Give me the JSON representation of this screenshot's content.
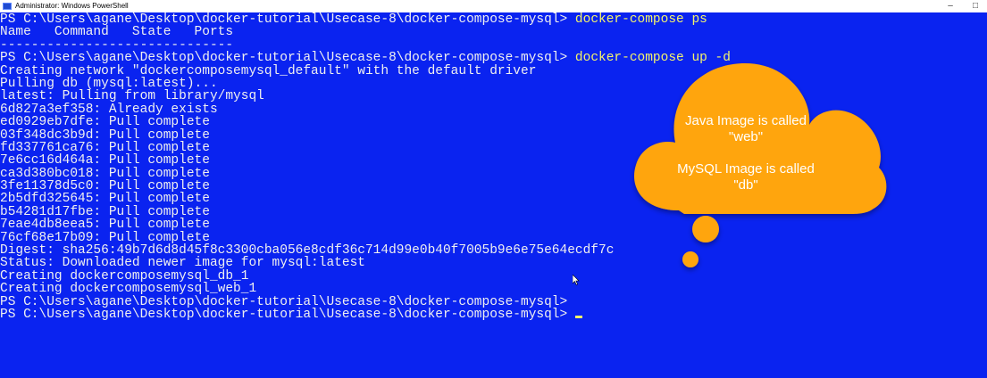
{
  "window": {
    "title": "Administrator: Windows PowerShell",
    "controls": {
      "minimize": "–",
      "maximize": "□"
    }
  },
  "console": {
    "prompt": "PS C:\\Users\\agane\\Desktop\\docker-tutorial\\Usecase-8\\docker-compose-mysql>",
    "lines": [
      {
        "prompt": true,
        "cmd": " docker-compose ps"
      },
      {
        "text": "Name   Command   State   Ports"
      },
      {
        "text": "------------------------------"
      },
      {
        "prompt": true,
        "cmd": " docker-compose up -d"
      },
      {
        "text": "Creating network \"dockercomposemysql_default\" with the default driver"
      },
      {
        "text": "Pulling db (mysql:latest)..."
      },
      {
        "text": "latest: Pulling from library/mysql"
      },
      {
        "text": "6d827a3ef358: Already exists"
      },
      {
        "text": "ed0929eb7dfe: Pull complete"
      },
      {
        "text": "03f348dc3b9d: Pull complete"
      },
      {
        "text": "fd337761ca76: Pull complete"
      },
      {
        "text": "7e6cc16d464a: Pull complete"
      },
      {
        "text": "ca3d380bc018: Pull complete"
      },
      {
        "text": "3fe11378d5c0: Pull complete"
      },
      {
        "text": "2b5dfd325645: Pull complete"
      },
      {
        "text": "b54281d17fbe: Pull complete"
      },
      {
        "text": "7eae4db8eea5: Pull complete"
      },
      {
        "text": "76cf68e17b09: Pull complete"
      },
      {
        "text": "Digest: sha256:49b7d6d8d45f8c3300cba056e8cdf36c714d99e0b40f7005b9e6e75e64ecdf7c"
      },
      {
        "text": "Status: Downloaded newer image for mysql:latest"
      },
      {
        "text": "Creating dockercomposemysql_db_1"
      },
      {
        "text": "Creating dockercomposemysql_web_1"
      },
      {
        "prompt": true,
        "cmd": ""
      },
      {
        "prompt": true,
        "cmd": " ",
        "cursor": true
      }
    ]
  },
  "callout": {
    "java_line1": "Java Image is called",
    "java_line2": "\"web\"",
    "mysql_line1": "MySQL Image is called",
    "mysql_line2": "\"db\"",
    "fill": "#ffa50a"
  },
  "colors": {
    "background": "#0a23f0",
    "text": "#f0f0f0",
    "command": "#f3f36c"
  }
}
